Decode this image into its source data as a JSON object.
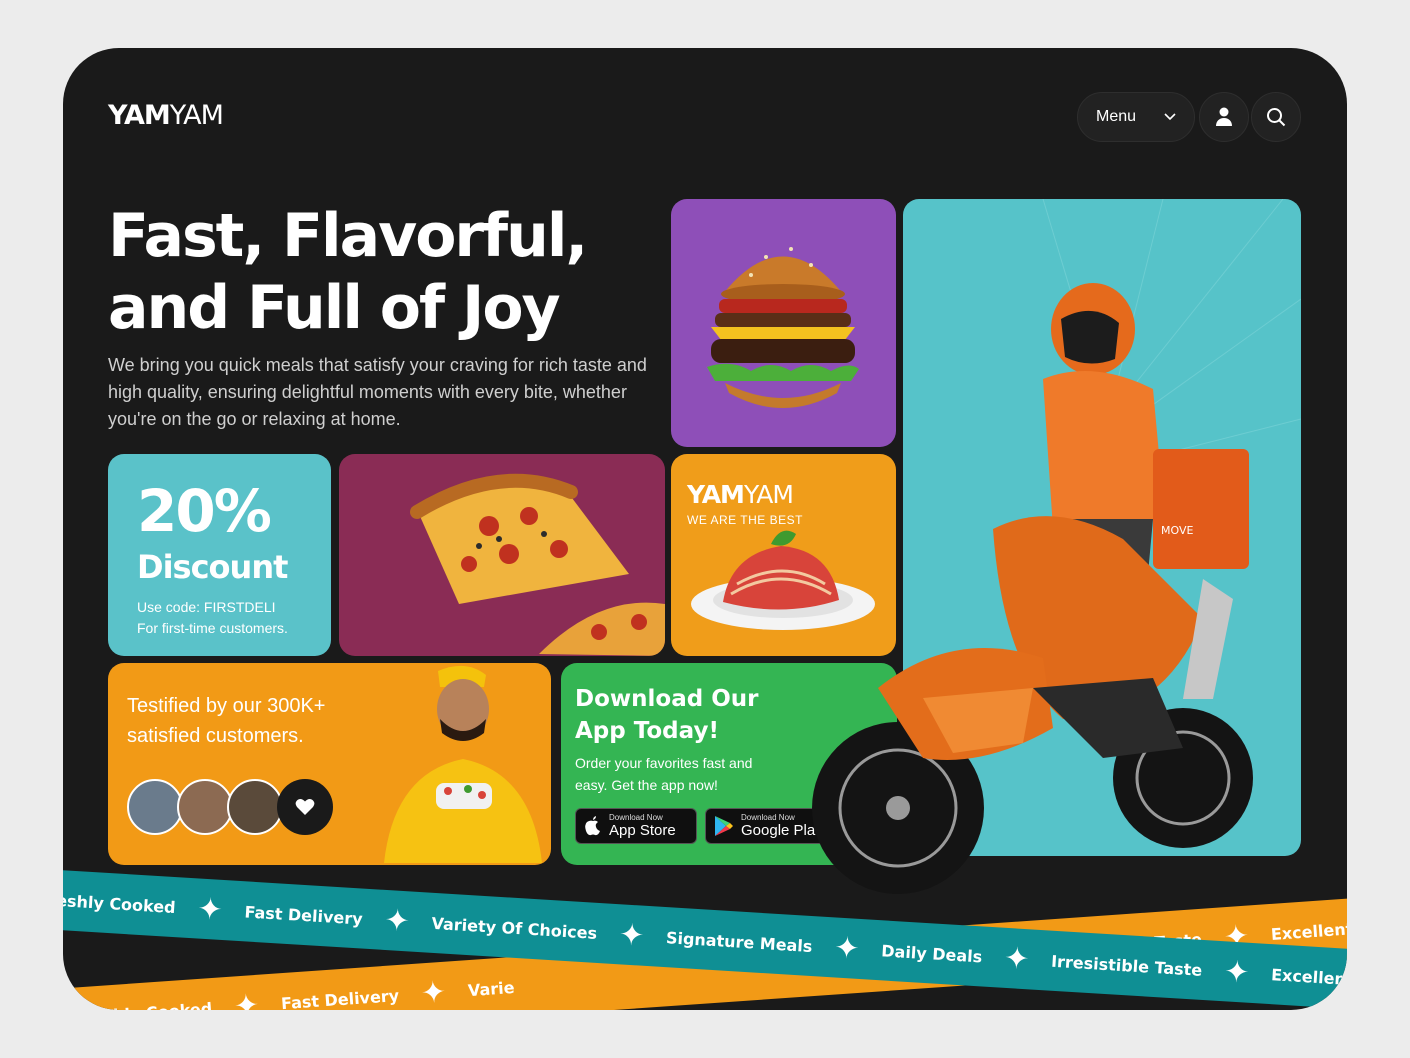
{
  "brand": {
    "bold": "YAM",
    "light": "YAM"
  },
  "nav": {
    "menu_label": "Menu"
  },
  "hero": {
    "title_line1": "Fast, Flavorful,",
    "title_line2": "and Full of Joy",
    "subtitle": "We bring you quick meals that satisfy your craving for rich taste and high quality, ensuring delightful moments with every bite, whether you're on the go or relaxing at home."
  },
  "discount": {
    "percent": "20%",
    "word": "Discount",
    "code_line": "Use code: FIRSTDELI",
    "note_line": "For first-time customers."
  },
  "yamcard": {
    "logo_bold": "YAM",
    "logo_light": "YAM",
    "tagline": "WE ARE THE BEST"
  },
  "testimonial": {
    "text": "Testified by our 300K+ satisfied customers."
  },
  "app": {
    "title": "Download Our App Today!",
    "subtitle": "Order your favorites fast and easy. Get the app now!",
    "appstore_small": "Download Now",
    "appstore_big": "App Store",
    "google_small": "Download Now",
    "google_big": "Google Pla"
  },
  "rider": {
    "box_text": "MOVE"
  },
  "band_teal": [
    "reshly Cooked",
    "Fast Delivery",
    "Variety Of Choices",
    "Signature Meals",
    "Daily Deals",
    "Irresistible Taste",
    "Excellent Serv"
  ],
  "band_orange_top": [
    "Irresistible Taste",
    "Excellent Serv"
  ],
  "band_orange_bottom": [
    "shly Cooked",
    "Fast Delivery",
    "Varie"
  ],
  "colors": {
    "teal": "#0f8f94",
    "orange": "#f29a16",
    "purple": "#8e4fb8",
    "green": "#34b553"
  }
}
